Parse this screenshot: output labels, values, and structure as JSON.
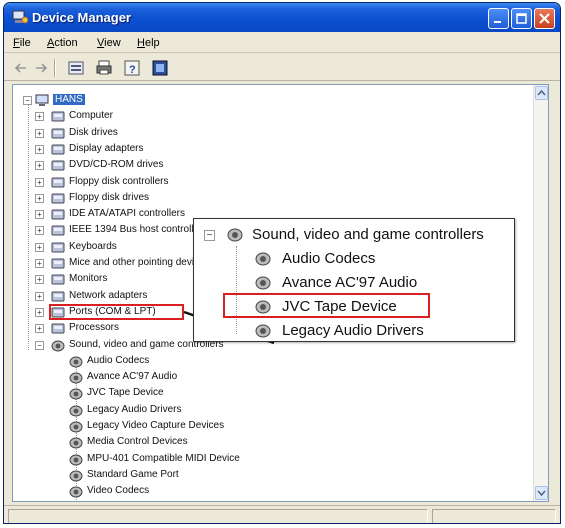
{
  "window": {
    "title": "Device Manager"
  },
  "menu": [
    {
      "underline": "F",
      "rest": "ile"
    },
    {
      "underline": "A",
      "rest": "ction"
    },
    {
      "underline": "V",
      "rest": "iew"
    },
    {
      "underline": "H",
      "rest": "elp"
    }
  ],
  "tree": {
    "root": "HANS",
    "categories": [
      {
        "label": "Computer",
        "icon": "computer-icon"
      },
      {
        "label": "Disk drives",
        "icon": "disk-drive-icon"
      },
      {
        "label": "Display adapters",
        "icon": "display-adapter-icon"
      },
      {
        "label": "DVD/CD-ROM drives",
        "icon": "dvd-drive-icon"
      },
      {
        "label": "Floppy disk controllers",
        "icon": "floppy-controller-icon"
      },
      {
        "label": "Floppy disk drives",
        "icon": "floppy-drive-icon"
      },
      {
        "label": "IDE ATA/ATAPI controllers",
        "icon": "ide-controller-icon"
      },
      {
        "label": "IEEE 1394 Bus host controllers",
        "icon": "ieee1394-icon"
      },
      {
        "label": "Keyboards",
        "icon": "keyboard-icon"
      },
      {
        "label": "Mice and other pointing devices",
        "icon": "mouse-icon"
      },
      {
        "label": "Monitors",
        "icon": "monitor-icon"
      },
      {
        "label": "Network adapters",
        "icon": "network-adapter-icon"
      },
      {
        "label": "Ports (COM & LPT)",
        "icon": "port-icon"
      },
      {
        "label": "Processors",
        "icon": "processor-icon"
      }
    ],
    "expanded": {
      "label": "Sound, video and game controllers",
      "children": [
        "Audio Codecs",
        "Avance AC'97 Audio",
        "JVC Tape Device",
        "Legacy Audio Drivers",
        "Legacy Video Capture Devices",
        "Media Control Devices",
        "MPU-401 Compatible MIDI Device",
        "Standard Game Port",
        "Video Codecs"
      ],
      "highlighted_child": "JVC Tape Device"
    }
  },
  "callout": {
    "title": "Sound, video and game controllers",
    "items": [
      "Audio Codecs",
      "Avance AC'97 Audio",
      "JVC Tape Device",
      "Legacy Audio Drivers"
    ]
  },
  "colors": {
    "title_bar": "#0b4fd1",
    "selection": "#316ac5",
    "highlight": "#d82020"
  }
}
